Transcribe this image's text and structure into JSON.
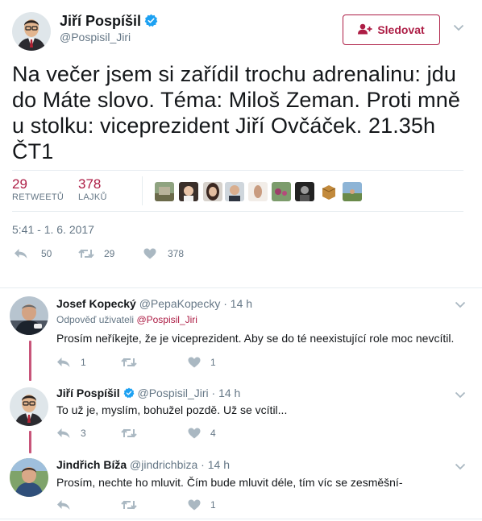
{
  "main_tweet": {
    "author_name": "Jiří Pospíšil",
    "author_handle": "@Pospisil_Jiri",
    "follow_label": "Sledovat",
    "text": "Na večer jsem si zařídil trochu adrenalinu: jdu do Máte slovo. Téma: Miloš Zeman. Proti mně u stolku: viceprezident Jiří Ovčáček. 21.35h ČT1",
    "retweets_count": "29",
    "retweets_label": "RETWEETŮ",
    "likes_count": "378",
    "likes_label": "LAJKŮ",
    "timestamp": "5:41 - 1. 6. 2017",
    "actions": {
      "reply_count": "50",
      "retweet_count": "29",
      "like_count": "378"
    }
  },
  "replies": [
    {
      "author_name": "Josef Kopecký",
      "author_handle": "@PepaKopecky",
      "time": "14 h",
      "reply_prefix": "Odpověď uživateli",
      "reply_to": "@Pospisil_Jiri",
      "text": "Prosím neříkejte, že je viceprezident. Aby se do té neexistující role moc nevcítil.",
      "reply_count": "1",
      "retweet_count": "",
      "like_count": "1"
    },
    {
      "author_name": "Jiří Pospíšil",
      "author_handle": "@Pospisil_Jiri",
      "time": "14 h",
      "text": "To už je, myslím, bohužel pozdě. Už se vcítil...",
      "reply_count": "3",
      "retweet_count": "",
      "like_count": "4"
    },
    {
      "author_name": "Jindřich Bíža",
      "author_handle": "@jindrichbiza",
      "time": "14 h",
      "text": "Prosím, nechte ho mluvit. Čím bude mluvit déle, tím víc se zesměšní-",
      "reply_count": "",
      "retweet_count": "",
      "like_count": "1"
    }
  ],
  "separator_dot": "·",
  "colors": {
    "accent": "#ad1d45",
    "verified": "#1da1f2",
    "thread_line": "#c8557a",
    "muted": "#657786"
  },
  "icons": [
    "verified-badge-icon",
    "follow-user-icon",
    "chevron-down-icon",
    "reply-icon",
    "retweet-icon",
    "heart-icon"
  ]
}
